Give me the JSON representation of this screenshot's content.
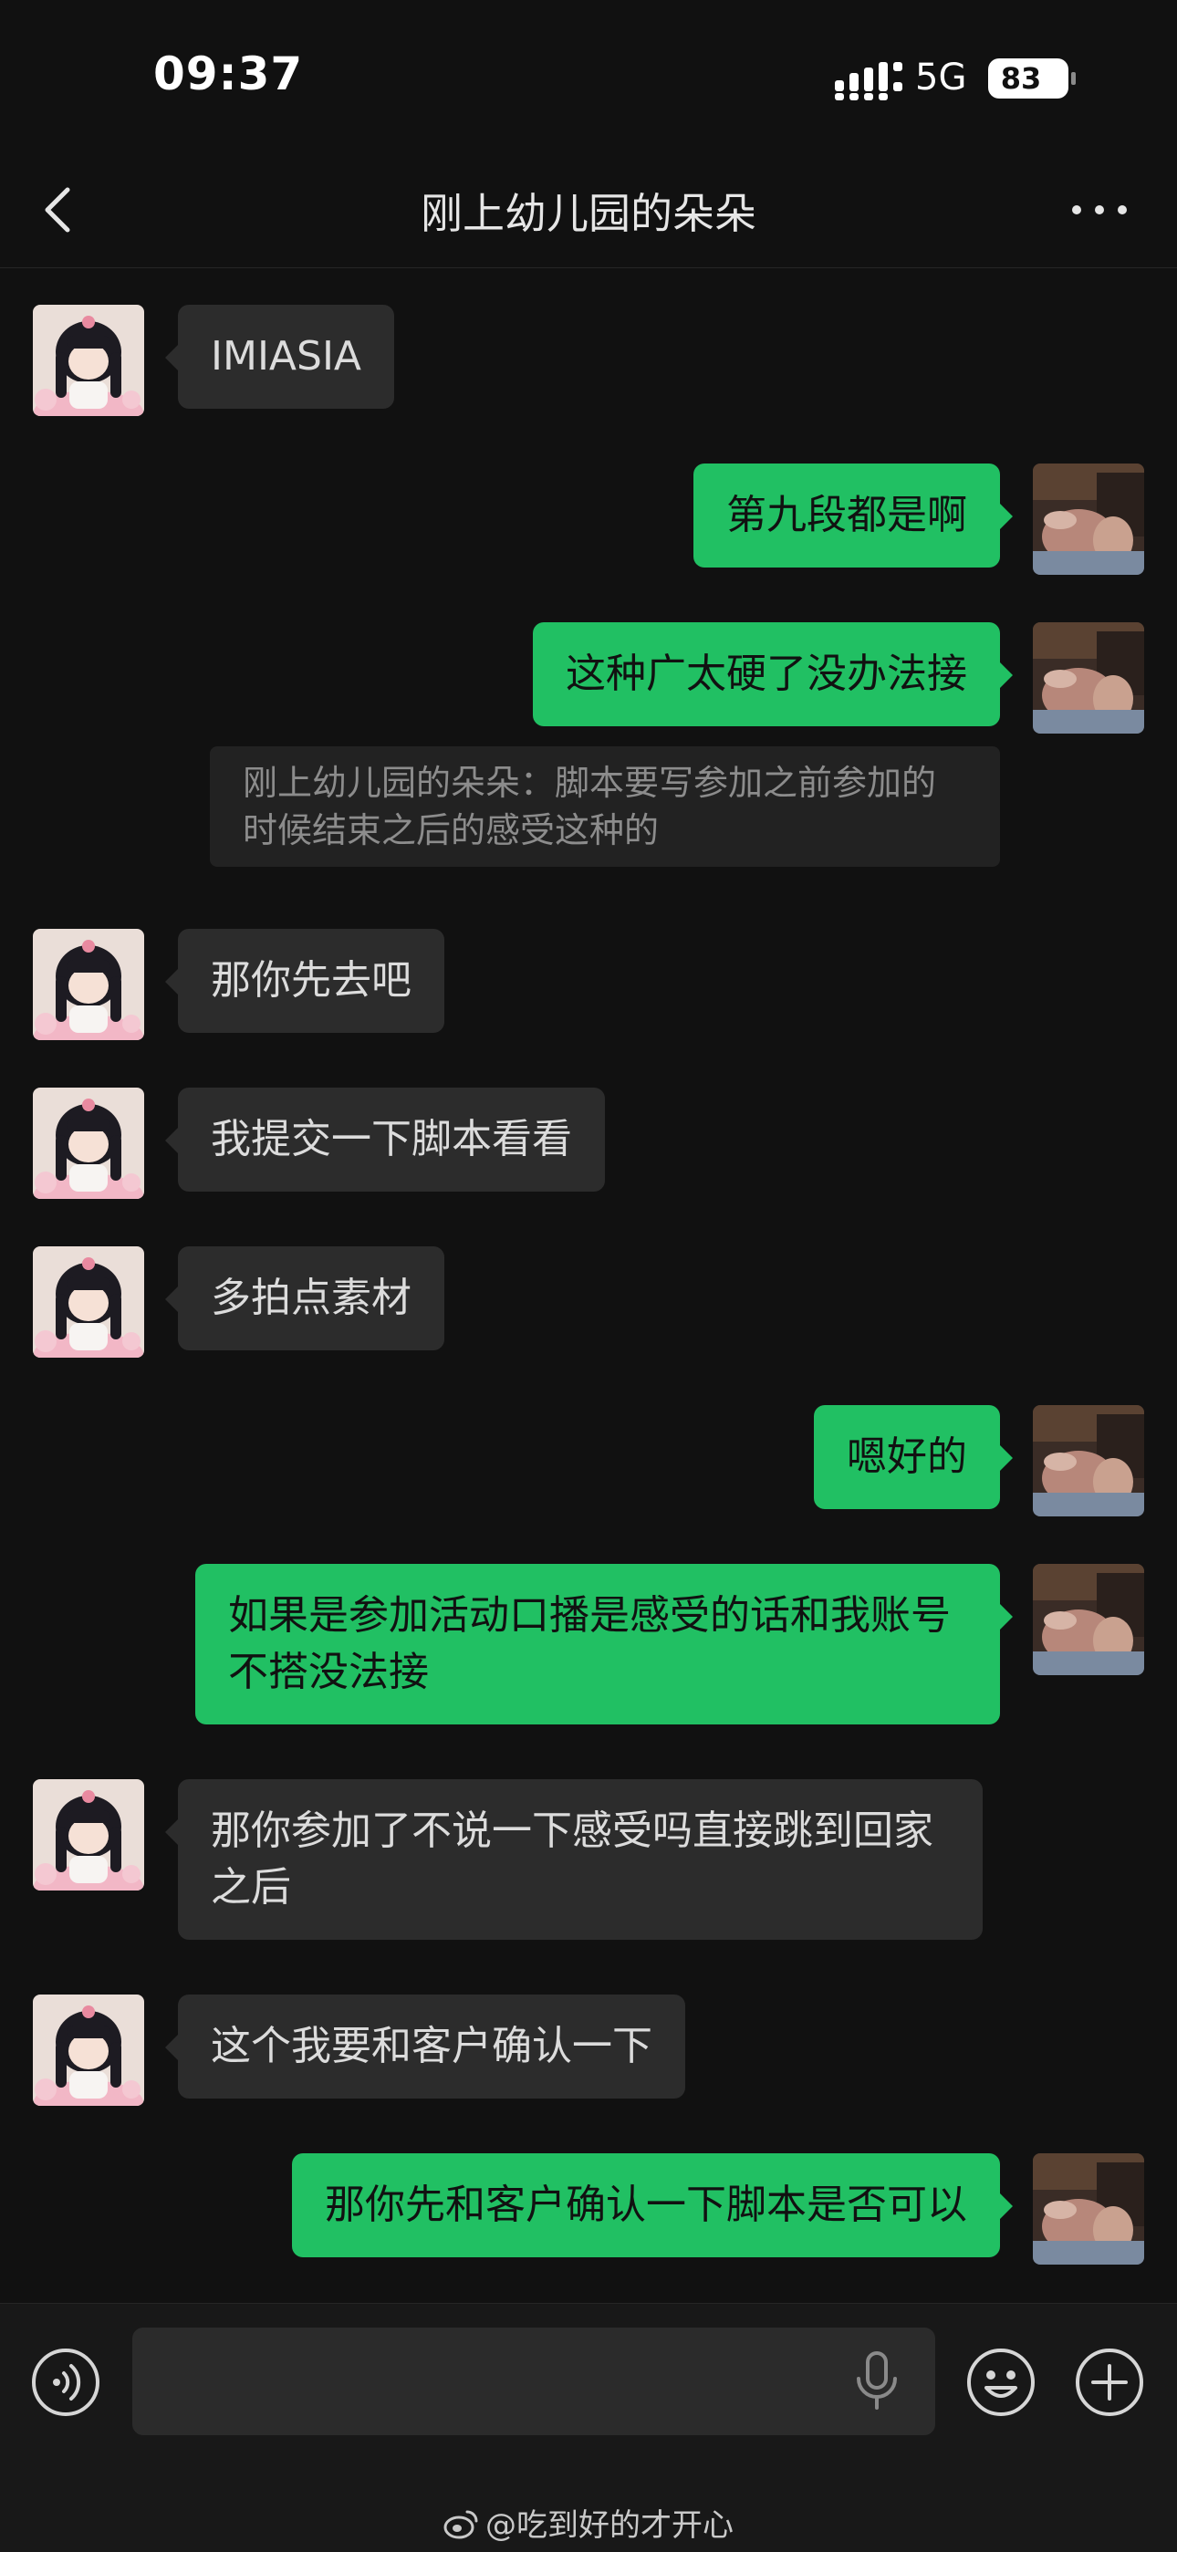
{
  "status": {
    "time": "09:37",
    "network": "5G",
    "battery": "83"
  },
  "header": {
    "title": "刚上幼儿园的朵朵"
  },
  "messages": [
    {
      "side": "in",
      "text": "IMIASIA"
    },
    {
      "side": "out",
      "text": "第九段都是啊"
    },
    {
      "side": "out",
      "text": "这种广太硬了没办法接"
    },
    {
      "quote": "刚上幼儿园的朵朵：脚本要写参加之前参加的时候结束之后的感受这种的"
    },
    {
      "side": "in",
      "text": "那你先去吧"
    },
    {
      "side": "in",
      "text": "我提交一下脚本看看"
    },
    {
      "side": "in",
      "text": "多拍点素材"
    },
    {
      "side": "out",
      "text": "嗯好的"
    },
    {
      "side": "out",
      "text": "如果是参加活动口播是感受的话和我账号不搭没法接"
    },
    {
      "side": "in",
      "text": "那你参加了不说一下感受吗直接跳到回家之后"
    },
    {
      "side": "in",
      "text": "这个我要和客户确认一下"
    },
    {
      "side": "out",
      "text": "那你先和客户确认一下脚本是否可以"
    }
  ],
  "input": {
    "value": ""
  },
  "watermark": "@吃到好的才开心",
  "colors": {
    "background": "#111111",
    "incoming_bubble": "#2c2c2c",
    "outgoing_bubble": "#21c063"
  },
  "icons": [
    "back-arrow-icon",
    "more-dots-icon",
    "voice-icon",
    "microphone-icon",
    "emoji-icon",
    "plus-icon",
    "weibo-icon"
  ]
}
